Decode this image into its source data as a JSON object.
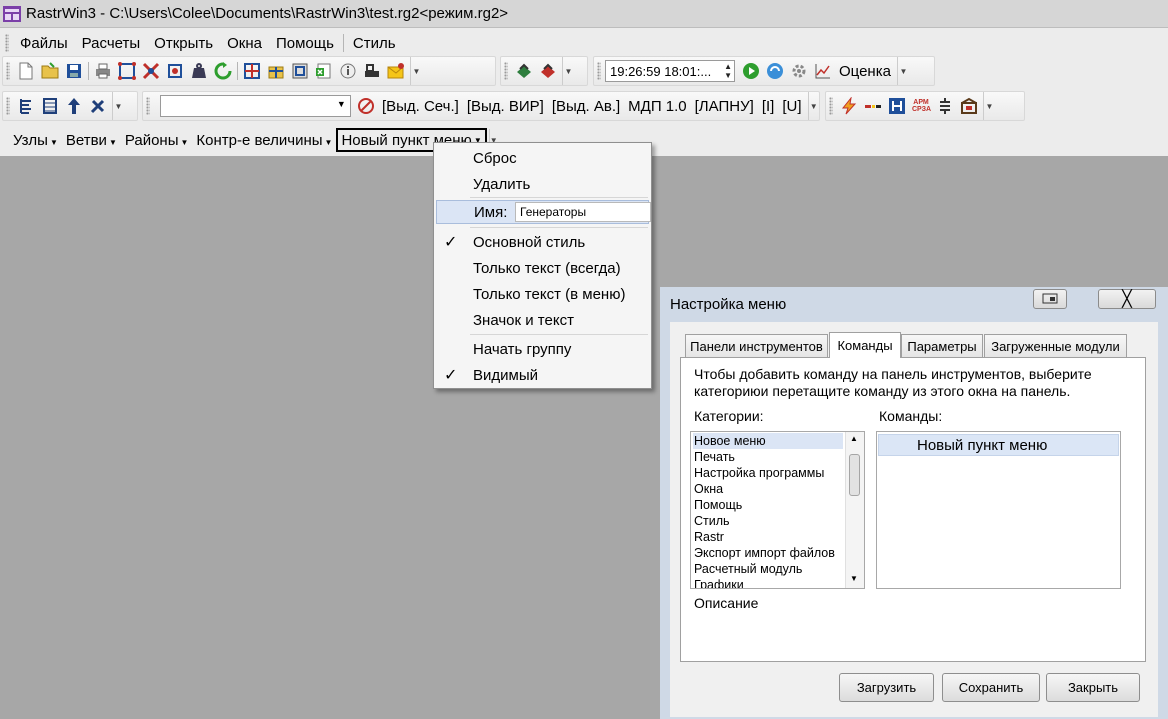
{
  "window": {
    "title": "RastrWin3 - C:\\Users\\Colee\\Documents\\RastrWin3\\test.rg2<режим.rg2>"
  },
  "menubar": {
    "items": [
      "Файлы",
      "Расчеты",
      "Открыть",
      "Окна",
      "Помощь",
      "Стиль"
    ]
  },
  "toolbar1": {
    "time_value": "19:26:59  18:01:...",
    "assessment_label": "Оценка"
  },
  "toolbar2": {
    "combo_value": "",
    "labels": [
      "[Выд. Сеч.]",
      "[Выд. ВИР]",
      "[Выд. Ав.]",
      "МДП 1.0",
      "[ЛАПНУ]",
      "[I]",
      "[U]"
    ],
    "arm_icon_text": "АРМ СРЗА"
  },
  "toolbar3": {
    "items": [
      "Узлы",
      "Ветви",
      "Районы",
      "Контр-е величины",
      "Новый пункт меню"
    ]
  },
  "context_menu": {
    "reset": "Сброс",
    "delete": "Удалить",
    "name_label": "Имя:",
    "name_value": "Генераторы",
    "base_style": "Основной стиль",
    "text_only_always": "Только текст (всегда)",
    "text_only_menu": "Только текст (в меню)",
    "icon_and_text": "Значок и текст",
    "begin_group": "Начать группу",
    "visible": "Видимый",
    "check_mark": "✓"
  },
  "dialog": {
    "title": "Настройка меню",
    "close_glyph": "╳",
    "tabs": [
      "Панели инструментов",
      "Команды",
      "Параметры",
      "Загруженные модули"
    ],
    "active_tab": "Команды",
    "hint": "Чтобы добавить команду на панель инструментов, выберите категориюи перетащите команду из этого окна на панель.",
    "categories_label": "Категории:",
    "commands_label": "Команды:",
    "categories": [
      "Новое меню",
      "Печать",
      "Настройка программы",
      "Окна",
      "Помощь",
      "Стиль",
      "Rastr",
      "Экспорт импорт файлов",
      "Расчетный модуль",
      "Графики"
    ],
    "selected_category": "Новое меню",
    "commands": [
      "Новый пункт меню"
    ],
    "description_label": "Описание",
    "buttons": {
      "load": "Загрузить",
      "save": "Сохранить",
      "close": "Закрыть"
    }
  },
  "colors": {
    "workspace": "#a7a7a7",
    "toolbar_bg": "#ececec",
    "selection": "#dbe5f5",
    "green_icon": "#2e9e2e",
    "blue_icon": "#1f4f9a",
    "red_icon": "#c0302a"
  }
}
